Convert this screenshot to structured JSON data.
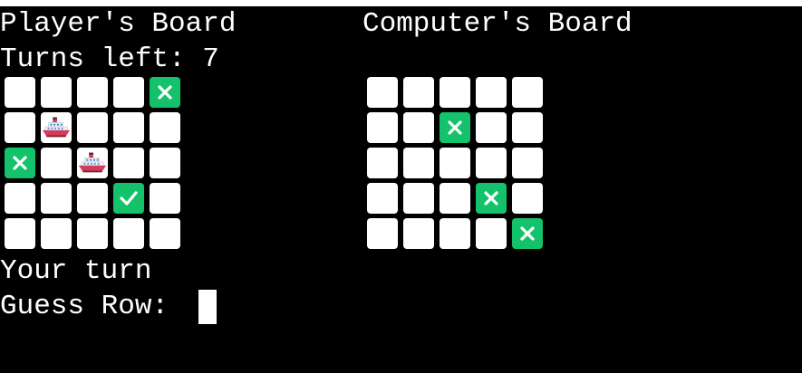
{
  "header": {
    "player_board_title": "Player's Board",
    "computer_board_title": "Computer's Board"
  },
  "status": {
    "turns_left": "Turns left: 7",
    "turn_message": "Your turn",
    "prompt": "Guess Row: "
  },
  "colors": {
    "background": "#000000",
    "text": "#ffffff",
    "mark_green": "#13c26b",
    "cell_white": "#ffffff"
  },
  "player_board": {
    "rows": [
      [
        "empty",
        "empty",
        "empty",
        "empty",
        "miss"
      ],
      [
        "empty",
        "ship",
        "empty",
        "empty",
        "empty"
      ],
      [
        "miss",
        "empty",
        "ship",
        "empty",
        "empty"
      ],
      [
        "empty",
        "empty",
        "empty",
        "hit",
        "empty"
      ],
      [
        "empty",
        "empty",
        "empty",
        "empty",
        "empty"
      ]
    ]
  },
  "computer_board": {
    "rows": [
      [
        "empty",
        "empty",
        "empty",
        "empty",
        "empty"
      ],
      [
        "empty",
        "empty",
        "miss",
        "empty",
        "empty"
      ],
      [
        "empty",
        "empty",
        "empty",
        "empty",
        "empty"
      ],
      [
        "empty",
        "empty",
        "empty",
        "miss",
        "empty"
      ],
      [
        "empty",
        "empty",
        "empty",
        "empty",
        "miss"
      ]
    ]
  },
  "icons": {
    "miss": "cross-mark-icon",
    "hit": "check-mark-icon",
    "ship": "ship-icon"
  }
}
